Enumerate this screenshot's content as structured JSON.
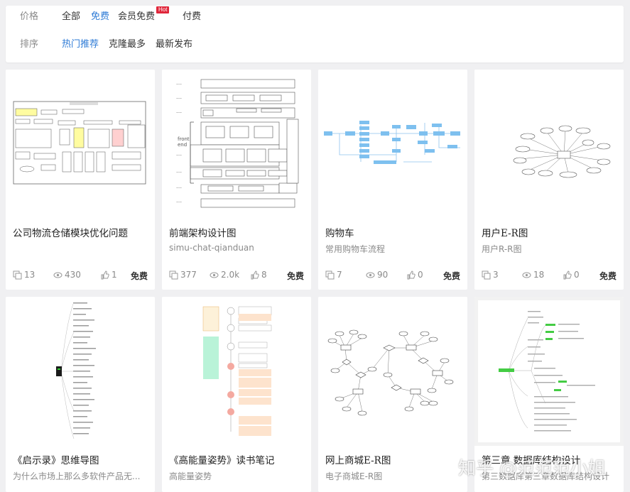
{
  "filters": {
    "price": {
      "label": "价格",
      "options": [
        "全部",
        "免费",
        "会员免费",
        "付费"
      ],
      "active": "免费",
      "hot_badge": "Hot"
    },
    "sort": {
      "label": "排序",
      "options": [
        "热门推荐",
        "克隆最多",
        "最新发布"
      ],
      "active": "热门推荐"
    }
  },
  "cards": [
    {
      "title": "公司物流仓储模块优化问题",
      "subtitle": "",
      "clones": "13",
      "views": "430",
      "likes": "1",
      "price": "免费",
      "thumb": "flowchart-icon"
    },
    {
      "title": "前端架构设计图",
      "subtitle": "simu-chat-qianduan",
      "clones": "377",
      "views": "2.0k",
      "likes": "8",
      "price": "免费",
      "thumb": "architecture-icon"
    },
    {
      "title": "购物车",
      "subtitle": "常用购物车流程",
      "clones": "7",
      "views": "90",
      "likes": "0",
      "price": "免费",
      "thumb": "blue-flow-icon"
    },
    {
      "title": "用户E-R图",
      "subtitle": "用户R-R图",
      "clones": "3",
      "views": "18",
      "likes": "0",
      "price": "免费",
      "thumb": "er-diagram-icon"
    },
    {
      "title": "《启示录》思维导图",
      "subtitle": "为什么市场上那么多软件产品无...",
      "thumb": "mindmap-icon"
    },
    {
      "title": "《高能量姿势》读书笔记",
      "subtitle": "高能量姿势",
      "thumb": "notes-icon"
    },
    {
      "title": "网上商城E-R图",
      "subtitle": "电子商城E-R图",
      "thumb": "er-network-icon"
    },
    {
      "title": "第三章 数据库结构设计",
      "subtitle": "第三数据库第三章数据库结构设计",
      "thumb": "mindmap-green-icon"
    }
  ],
  "watermark": "知乎 @范范范小姐",
  "colors": {
    "accent": "#2e7bd6",
    "hot": "#e0263a",
    "muted": "#8a8a8a"
  }
}
